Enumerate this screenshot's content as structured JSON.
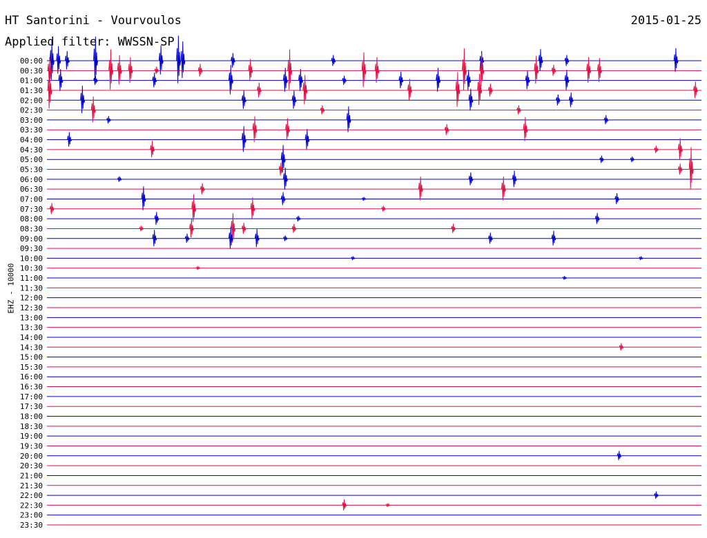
{
  "header": {
    "title": "HT Santorini - Vourvoulos",
    "date": "2015-01-25",
    "filter": "Applied filter: WWSSN-SP",
    "channel_label": "EHZ - 10000"
  },
  "colors": {
    "blue": "#0000cc",
    "red": "#dd1144"
  },
  "chart_data": {
    "type": "line",
    "title": "HT Santorini - Vourvoulos",
    "ylabel": "EHZ - 10000",
    "xlabel": "",
    "legend": "none",
    "traces": [
      "00:00",
      "00:30",
      "01:00",
      "01:30",
      "02:00",
      "02:30",
      "03:00",
      "03:30",
      "04:00",
      "04:30",
      "05:00",
      "05:30",
      "06:00",
      "06:30",
      "07:00",
      "07:30",
      "08:00",
      "08:30",
      "09:00",
      "09:30",
      "10:00",
      "10:30",
      "11:00",
      "11:30",
      "12:00",
      "12:30",
      "13:00",
      "13:30",
      "14:00",
      "14:30",
      "15:00",
      "15:30",
      "16:00",
      "16:30",
      "17:00",
      "17:30",
      "18:00",
      "18:30",
      "19:00",
      "19:30",
      "20:00",
      "20:30",
      "21:00",
      "21:30",
      "22:00",
      "22:30",
      "23:00",
      "23:30"
    ],
    "trace_minutes": 30,
    "events": [
      {
        "trace": 0,
        "minute": 0.2,
        "amp": 2.2
      },
      {
        "trace": 0,
        "minute": 0.5,
        "amp": 1.5
      },
      {
        "trace": 0,
        "minute": 0.9,
        "amp": 1.0
      },
      {
        "trace": 0,
        "minute": 2.2,
        "amp": 2.5
      },
      {
        "trace": 0,
        "minute": 5.2,
        "amp": 1.6
      },
      {
        "trace": 0,
        "minute": 6.0,
        "amp": 2.6
      },
      {
        "trace": 0,
        "minute": 6.2,
        "amp": 2.0
      },
      {
        "trace": 0,
        "minute": 8.5,
        "amp": 0.8
      },
      {
        "trace": 0,
        "minute": 13.1,
        "amp": 0.6
      },
      {
        "trace": 0,
        "minute": 19.9,
        "amp": 1.0
      },
      {
        "trace": 0,
        "minute": 22.6,
        "amp": 1.2
      },
      {
        "trace": 0,
        "minute": 23.8,
        "amp": 0.6
      },
      {
        "trace": 0,
        "minute": 28.8,
        "amp": 1.3
      },
      {
        "trace": 1,
        "minute": 0.1,
        "amp": 1.4
      },
      {
        "trace": 1,
        "minute": 2.9,
        "amp": 2.2
      },
      {
        "trace": 1,
        "minute": 3.3,
        "amp": 1.6
      },
      {
        "trace": 1,
        "minute": 3.8,
        "amp": 1.4
      },
      {
        "trace": 1,
        "minute": 5.0,
        "amp": 0.4
      },
      {
        "trace": 1,
        "minute": 7.0,
        "amp": 0.7
      },
      {
        "trace": 1,
        "minute": 9.3,
        "amp": 1.2
      },
      {
        "trace": 1,
        "minute": 11.1,
        "amp": 2.2
      },
      {
        "trace": 1,
        "minute": 14.5,
        "amp": 1.9
      },
      {
        "trace": 1,
        "minute": 15.1,
        "amp": 1.4
      },
      {
        "trace": 1,
        "minute": 19.1,
        "amp": 2.3
      },
      {
        "trace": 1,
        "minute": 19.9,
        "amp": 1.8
      },
      {
        "trace": 1,
        "minute": 22.4,
        "amp": 1.5
      },
      {
        "trace": 1,
        "minute": 23.2,
        "amp": 0.6
      },
      {
        "trace": 1,
        "minute": 24.8,
        "amp": 1.4
      },
      {
        "trace": 1,
        "minute": 25.3,
        "amp": 1.3
      },
      {
        "trace": 2,
        "minute": 0.6,
        "amp": 1.2
      },
      {
        "trace": 2,
        "minute": 2.2,
        "amp": 0.5
      },
      {
        "trace": 2,
        "minute": 4.9,
        "amp": 0.8
      },
      {
        "trace": 2,
        "minute": 8.4,
        "amp": 1.6
      },
      {
        "trace": 2,
        "minute": 10.9,
        "amp": 1.3
      },
      {
        "trace": 2,
        "minute": 11.6,
        "amp": 1.2
      },
      {
        "trace": 2,
        "minute": 13.6,
        "amp": 0.5
      },
      {
        "trace": 2,
        "minute": 16.2,
        "amp": 0.9
      },
      {
        "trace": 2,
        "minute": 17.9,
        "amp": 1.3
      },
      {
        "trace": 2,
        "minute": 19.3,
        "amp": 1.1
      },
      {
        "trace": 2,
        "minute": 22.0,
        "amp": 1.0
      },
      {
        "trace": 2,
        "minute": 23.8,
        "amp": 1.1
      },
      {
        "trace": 3,
        "minute": 0.1,
        "amp": 2.1
      },
      {
        "trace": 3,
        "minute": 9.7,
        "amp": 0.8
      },
      {
        "trace": 3,
        "minute": 11.8,
        "amp": 1.6
      },
      {
        "trace": 3,
        "minute": 16.6,
        "amp": 1.2
      },
      {
        "trace": 3,
        "minute": 18.8,
        "amp": 1.9
      },
      {
        "trace": 3,
        "minute": 19.8,
        "amp": 1.7
      },
      {
        "trace": 3,
        "minute": 20.3,
        "amp": 0.7
      },
      {
        "trace": 3,
        "minute": 29.7,
        "amp": 0.9
      },
      {
        "trace": 4,
        "minute": 1.6,
        "amp": 1.5
      },
      {
        "trace": 4,
        "minute": 9.0,
        "amp": 1.0
      },
      {
        "trace": 4,
        "minute": 11.3,
        "amp": 1.0
      },
      {
        "trace": 4,
        "minute": 19.4,
        "amp": 1.2
      },
      {
        "trace": 4,
        "minute": 23.4,
        "amp": 0.6
      },
      {
        "trace": 4,
        "minute": 24.0,
        "amp": 0.8
      },
      {
        "trace": 5,
        "minute": 2.1,
        "amp": 1.4
      },
      {
        "trace": 5,
        "minute": 12.6,
        "amp": 0.5
      },
      {
        "trace": 5,
        "minute": 21.6,
        "amp": 0.5
      },
      {
        "trace": 6,
        "minute": 2.8,
        "amp": 0.4
      },
      {
        "trace": 6,
        "minute": 13.8,
        "amp": 1.4
      },
      {
        "trace": 6,
        "minute": 25.6,
        "amp": 0.5
      },
      {
        "trace": 7,
        "minute": 9.5,
        "amp": 1.4
      },
      {
        "trace": 7,
        "minute": 11.0,
        "amp": 1.2
      },
      {
        "trace": 7,
        "minute": 18.3,
        "amp": 0.6
      },
      {
        "trace": 7,
        "minute": 21.9,
        "amp": 1.3
      },
      {
        "trace": 8,
        "minute": 1.0,
        "amp": 0.8
      },
      {
        "trace": 8,
        "minute": 9.0,
        "amp": 1.4
      },
      {
        "trace": 8,
        "minute": 11.9,
        "amp": 1.1
      },
      {
        "trace": 9,
        "minute": 4.8,
        "amp": 0.9
      },
      {
        "trace": 9,
        "minute": 27.9,
        "amp": 0.4
      },
      {
        "trace": 9,
        "minute": 29.0,
        "amp": 1.2
      },
      {
        "trace": 10,
        "minute": 10.8,
        "amp": 1.5
      },
      {
        "trace": 10,
        "minute": 25.4,
        "amp": 0.4
      },
      {
        "trace": 10,
        "minute": 26.8,
        "amp": 0.3
      },
      {
        "trace": 11,
        "minute": 10.7,
        "amp": 0.7
      },
      {
        "trace": 11,
        "minute": 29.0,
        "amp": 0.6
      },
      {
        "trace": 11,
        "minute": 29.5,
        "amp": 2.3
      },
      {
        "trace": 12,
        "minute": 3.3,
        "amp": 0.3
      },
      {
        "trace": 12,
        "minute": 10.9,
        "amp": 1.2
      },
      {
        "trace": 12,
        "minute": 19.4,
        "amp": 0.7
      },
      {
        "trace": 12,
        "minute": 21.4,
        "amp": 0.9
      },
      {
        "trace": 13,
        "minute": 7.1,
        "amp": 0.6
      },
      {
        "trace": 13,
        "minute": 17.1,
        "amp": 1.3
      },
      {
        "trace": 13,
        "minute": 20.9,
        "amp": 1.3
      },
      {
        "trace": 14,
        "minute": 4.4,
        "amp": 1.3
      },
      {
        "trace": 14,
        "minute": 10.8,
        "amp": 0.7
      },
      {
        "trace": 14,
        "minute": 14.5,
        "amp": 0.2
      },
      {
        "trace": 14,
        "minute": 26.1,
        "amp": 0.6
      },
      {
        "trace": 15,
        "minute": 0.2,
        "amp": 0.6
      },
      {
        "trace": 15,
        "minute": 6.7,
        "amp": 1.5
      },
      {
        "trace": 15,
        "minute": 9.4,
        "amp": 1.2
      },
      {
        "trace": 15,
        "minute": 15.4,
        "amp": 0.3
      },
      {
        "trace": 16,
        "minute": 5.0,
        "amp": 0.7
      },
      {
        "trace": 16,
        "minute": 11.5,
        "amp": 0.3
      },
      {
        "trace": 16,
        "minute": 25.2,
        "amp": 0.6
      },
      {
        "trace": 17,
        "minute": 4.3,
        "amp": 0.3
      },
      {
        "trace": 17,
        "minute": 6.6,
        "amp": 1.0
      },
      {
        "trace": 17,
        "minute": 8.5,
        "amp": 1.6
      },
      {
        "trace": 17,
        "minute": 9.0,
        "amp": 0.6
      },
      {
        "trace": 17,
        "minute": 11.3,
        "amp": 0.5
      },
      {
        "trace": 17,
        "minute": 18.6,
        "amp": 0.5
      },
      {
        "trace": 18,
        "minute": 4.9,
        "amp": 0.9
      },
      {
        "trace": 18,
        "minute": 6.4,
        "amp": 0.5
      },
      {
        "trace": 18,
        "minute": 8.4,
        "amp": 1.2
      },
      {
        "trace": 18,
        "minute": 9.6,
        "amp": 1.0
      },
      {
        "trace": 18,
        "minute": 10.9,
        "amp": 0.3
      },
      {
        "trace": 18,
        "minute": 20.3,
        "amp": 0.6
      },
      {
        "trace": 18,
        "minute": 23.2,
        "amp": 0.8
      },
      {
        "trace": 20,
        "minute": 14.0,
        "amp": 0.2
      },
      {
        "trace": 20,
        "minute": 27.2,
        "amp": 0.2
      },
      {
        "trace": 21,
        "minute": 6.9,
        "amp": 0.2
      },
      {
        "trace": 22,
        "minute": 23.7,
        "amp": 0.2
      },
      {
        "trace": 29,
        "minute": 26.3,
        "amp": 0.4
      },
      {
        "trace": 40,
        "minute": 26.2,
        "amp": 0.5
      },
      {
        "trace": 44,
        "minute": 27.9,
        "amp": 0.4
      },
      {
        "trace": 45,
        "minute": 13.6,
        "amp": 0.6
      },
      {
        "trace": 45,
        "minute": 15.6,
        "amp": 0.2
      }
    ]
  }
}
